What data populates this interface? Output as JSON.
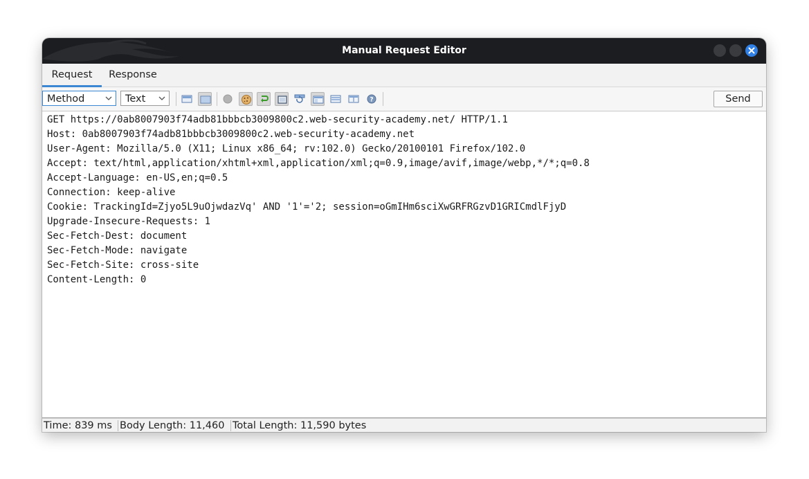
{
  "window": {
    "title": "Manual Request Editor"
  },
  "tabs": [
    {
      "label": "Request",
      "active": true
    },
    {
      "label": "Response",
      "active": false
    }
  ],
  "toolbar": {
    "method_select": "Method",
    "format_select": "Text",
    "send_label": "Send"
  },
  "request_lines": [
    "GET https://0ab8007903f74adb81bbbcb3009800c2.web-security-academy.net/ HTTP/1.1",
    "Host: 0ab8007903f74adb81bbbcb3009800c2.web-security-academy.net",
    "User-Agent: Mozilla/5.0 (X11; Linux x86_64; rv:102.0) Gecko/20100101 Firefox/102.0",
    "Accept: text/html,application/xhtml+xml,application/xml;q=0.9,image/avif,image/webp,*/*;q=0.8",
    "Accept-Language: en-US,en;q=0.5",
    "Connection: keep-alive",
    "Cookie: TrackingId=Zjyo5L9uOjwdazVq' AND '1'='2; session=oGmIHm6sciXwGRFRGzvD1GRICmdlFjyD",
    "Upgrade-Insecure-Requests: 1",
    "Sec-Fetch-Dest: document",
    "Sec-Fetch-Mode: navigate",
    "Sec-Fetch-Site: cross-site",
    "Content-Length: 0"
  ],
  "status": {
    "time": "Time: 839 ms",
    "body_length": "Body Length: 11,460",
    "total_length": "Total Length: 11,590 bytes"
  }
}
